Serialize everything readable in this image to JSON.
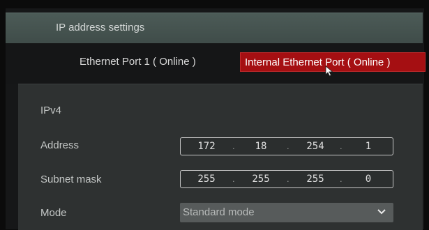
{
  "header": {
    "title": "IP address settings"
  },
  "tabs": [
    {
      "label": "Ethernet Port 1 ( Online )",
      "selected": false
    },
    {
      "label": "Internal Ethernet Port ( Online )",
      "selected": true
    }
  ],
  "section": {
    "label": "IPv4"
  },
  "address": {
    "label": "Address",
    "octets": [
      "172",
      "18",
      "254",
      "1"
    ]
  },
  "subnet": {
    "label": "Subnet mask",
    "octets": [
      "255",
      "255",
      "255",
      "0"
    ]
  },
  "mode": {
    "label": "Mode",
    "selected": "Standard mode"
  },
  "icons": {
    "cursor": "mouse-pointer-icon",
    "dropdown": "chevron-down-icon"
  },
  "colors": {
    "active_tab": "#a50f12",
    "header": "#4c5b57",
    "panel": "#2e3131"
  }
}
